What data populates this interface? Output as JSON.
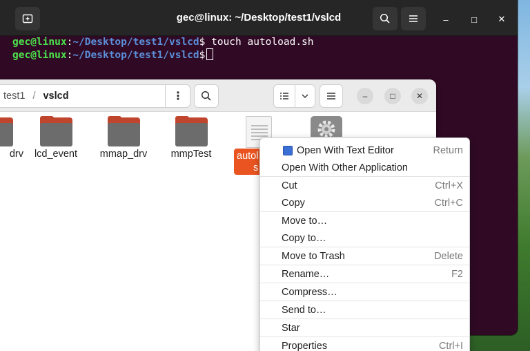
{
  "terminal": {
    "title": "gec@linux: ~/Desktop/test1/vslcd",
    "lines": [
      {
        "user": "gec@linux",
        "sep": ":",
        "path": "~/Desktop/test1/vslcd",
        "prompt": "$",
        "command": " touch autoload.sh"
      },
      {
        "user": "gec@linux",
        "sep": ":",
        "path": "~/Desktop/test1/vslcd",
        "prompt": "$",
        "command": " "
      }
    ],
    "buttons": {
      "minimize": "–",
      "maximize": "□",
      "close": "✕"
    }
  },
  "files": {
    "breadcrumb": {
      "parent": "test1",
      "separator": "/",
      "current": "vslcd"
    },
    "path_more": "⋮",
    "items": [
      {
        "name": "drv"
      },
      {
        "name": "lcd_event"
      },
      {
        "name": "mmap_drv"
      },
      {
        "name": "mmpTest"
      }
    ],
    "selected_item": {
      "line1": "autol",
      "line2": "s"
    },
    "buttons": {
      "minimize": "–",
      "maximize": "□",
      "close": "✕"
    }
  },
  "context_menu": {
    "items": [
      {
        "label": "Open With Text Editor",
        "accel": "Return"
      },
      {
        "label": "Open With Other Application",
        "accel": ""
      },
      {
        "label": "Cut",
        "accel": "Ctrl+X"
      },
      {
        "label": "Copy",
        "accel": "Ctrl+C"
      },
      {
        "label": "Move to…",
        "accel": ""
      },
      {
        "label": "Copy to…",
        "accel": ""
      },
      {
        "label": "Move to Trash",
        "accel": "Delete"
      },
      {
        "label": "Rename…",
        "accel": "F2"
      },
      {
        "label": "Compress…",
        "accel": ""
      },
      {
        "label": "Send to…",
        "accel": ""
      },
      {
        "label": "Star",
        "accel": ""
      },
      {
        "label": "Properties",
        "accel": "Ctrl+I"
      }
    ]
  },
  "colors": {
    "terminal_bg": "#300a24",
    "prompt_user": "#4ce54c",
    "prompt_path": "#5b8fd9",
    "selection": "#e95420"
  }
}
